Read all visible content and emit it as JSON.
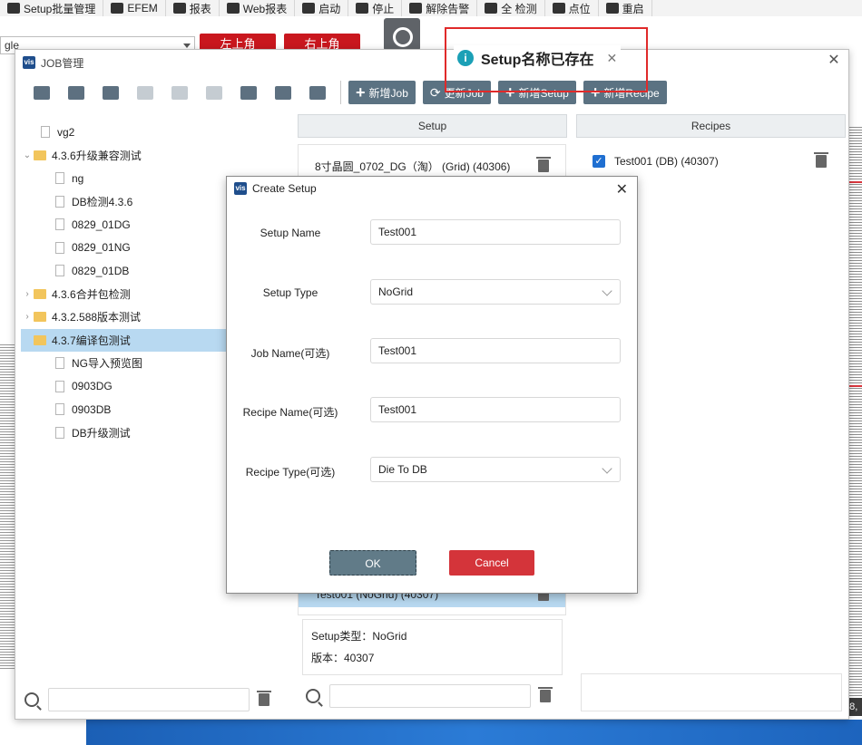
{
  "background": {
    "toolbar_items": [
      "Setup批量管理",
      "EFEM",
      "报表",
      "Web报表",
      "启动",
      "停止",
      "解除告警",
      "全 检测",
      "点位",
      "重启"
    ],
    "combo_value": "gle",
    "red_buttons": [
      "左上角",
      "右上角"
    ],
    "status_text": "08,"
  },
  "job_window": {
    "title": "JOB管理",
    "logo": "vis",
    "toolbar_buttons": [
      "新增Job",
      "更新Job",
      "新增Setup",
      "新增Recipe"
    ],
    "tree": [
      {
        "label": "vg2",
        "type": "file",
        "expander": false,
        "selected": false
      },
      {
        "label": "4.3.6升级兼容测试",
        "type": "folder",
        "expander": "open",
        "selected": false
      },
      {
        "label": "ng",
        "type": "file",
        "expander": false,
        "selected": false
      },
      {
        "label": "DB检测4.3.6",
        "type": "file",
        "expander": false,
        "selected": false
      },
      {
        "label": "0829_01DG",
        "type": "file",
        "expander": false,
        "selected": false
      },
      {
        "label": "0829_01NG",
        "type": "file",
        "expander": false,
        "selected": false
      },
      {
        "label": "0829_01DB",
        "type": "file",
        "expander": false,
        "selected": false
      },
      {
        "label": "4.3.6合并包检测",
        "type": "folder",
        "expander": "closed",
        "selected": false
      },
      {
        "label": "4.3.2.588版本测试",
        "type": "folder",
        "expander": "closed",
        "selected": false
      },
      {
        "label": "4.3.7编译包测试",
        "type": "folder",
        "expander": false,
        "selected": true
      },
      {
        "label": "NG导入预览图",
        "type": "file",
        "expander": false,
        "selected": false
      },
      {
        "label": "0903DG",
        "type": "file",
        "expander": false,
        "selected": false
      },
      {
        "label": "0903DB",
        "type": "file",
        "expander": false,
        "selected": false
      },
      {
        "label": "DB升级测试",
        "type": "file",
        "expander": false,
        "selected": false
      }
    ],
    "setup_header": "Setup",
    "setup_rows": {
      "first": "8寸晶圆_0702_DG（淘） (Grid) (40306)",
      "selected": "Test001 (NoGrid) (40307)"
    },
    "setup_info": {
      "type_line": "Setup类型：NoGrid",
      "version_line": "版本：40307"
    },
    "recipes_header": "Recipes",
    "recipe_row": "Test001 (DB) (40307)"
  },
  "toast": {
    "message": "Setup名称已存在"
  },
  "dialog": {
    "title": "Create Setup",
    "logo": "vis",
    "fields": {
      "setup_name": {
        "label": "Setup Name",
        "value": "Test001"
      },
      "setup_type": {
        "label": "Setup Type",
        "value": "NoGrid"
      },
      "job_name": {
        "label": "Job Name(可选)",
        "value": "Test001"
      },
      "recipe_name": {
        "label": "Recipe Name(可选)",
        "value": "Test001"
      },
      "recipe_type": {
        "label": "Recipe Type(可选)",
        "value": "Die To DB"
      }
    },
    "ok_label": "OK",
    "cancel_label": "Cancel"
  }
}
